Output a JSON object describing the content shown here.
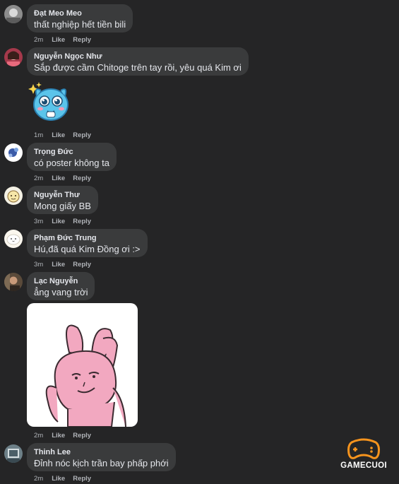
{
  "comments": [
    {
      "name": "Đạt Meo Meo",
      "text": "thất nghiệp hết tiền bili",
      "time": "2m",
      "like": "Like",
      "reply": "Reply"
    },
    {
      "name": "Nguyễn Ngọc Như",
      "text": "Sắp được cầm Chitoge trên tay rồi, yêu quá Kim ơi",
      "time": "1m",
      "like": "Like",
      "reply": "Reply",
      "sticker": "blue-cat-sticker"
    },
    {
      "name": "Trọng Đức",
      "text": "có poster không ta",
      "time": "2m",
      "like": "Like",
      "reply": "Reply"
    },
    {
      "name": "Nguyễn Thư",
      "text": "Mong giấy BB",
      "time": "3m",
      "like": "Like",
      "reply": "Reply"
    },
    {
      "name": "Phạm Đức Trung",
      "text": "Hú,đã quá Kim Đồng ơi :>",
      "time": "3m",
      "like": "Like",
      "reply": "Reply"
    },
    {
      "name": "Lạc Nguyễn",
      "text": "ẳng vang trời",
      "time": "2m",
      "like": "Like",
      "reply": "Reply",
      "sticker": "pink-rabbit-sticker"
    },
    {
      "name": "Thinh Lee",
      "text": "Đỉnh nóc kịch trần bay phấp phới",
      "time": "2m",
      "like": "Like",
      "reply": "Reply"
    }
  ],
  "watermark": {
    "text": "GAMECUOI",
    "accent": "#f7941d"
  },
  "colors": {
    "background": "#252526",
    "bubble": "#3a3b3c",
    "meta": "#b0b3b8"
  }
}
